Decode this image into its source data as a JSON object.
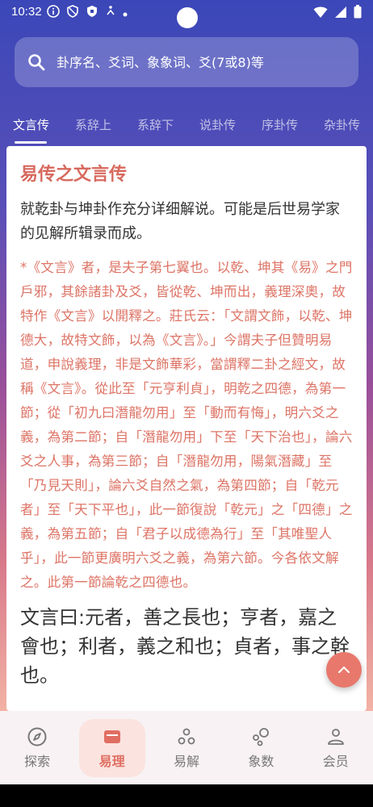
{
  "status_bar": {
    "time": "10:32"
  },
  "search": {
    "placeholder": "卦序名、爻词、象象词、爻(7或8)等"
  },
  "tabs": [
    {
      "label": "文言传"
    },
    {
      "label": "系辞上"
    },
    {
      "label": "系辞下"
    },
    {
      "label": "说卦传"
    },
    {
      "label": "序卦传"
    },
    {
      "label": "杂卦传"
    }
  ],
  "content": {
    "title": "易传之文言传",
    "subtitle": "就乾卦与坤卦作充分详细解说。可能是后世易学家的见解所辑录而成。",
    "note": "*《文言》者，是夫子第七翼也。以乾、坤其《易》之門戶邪，其餘諸卦及爻，皆從乾、坤而出，義理深奧，故特作《文言》以開釋之。莊氏云：「文謂文飾，以乾、坤德大，故特文飾，以為《文言》。」今謂夫子但贊明易道，申說義理，非是文飾華彩，當謂釋二卦之經文，故稱《文言》。從此至「元亨利貞」，明乾之四德，為第一節；從「初九曰潛龍勿用」至「動而有悔」，明六爻之義，為第二節；自「潛龍勿用」下至「天下治也」，論六爻之人事，為第三節；自「潛龍勿用，陽氣潛藏」至「乃見天則」，論六爻自然之氣，為第四節；自「乾元者」至「天下平也」，此一節復說「乾元」之「四德」之義，為第五節；自「君子以成德為行」至「其唯聖人乎」，此一節更廣明六爻之義，為第六節。今各依文解之。此第一節論乾之四德也。",
    "body": "文言曰:元者，善之長也；亨者，嘉之會也；利者，義之和也；貞者，事之幹也。"
  },
  "bottom_nav": [
    {
      "label": "探索",
      "icon": "compass-icon"
    },
    {
      "label": "易理",
      "icon": "book-icon"
    },
    {
      "label": "易解",
      "icon": "dots-icon"
    },
    {
      "label": "象数",
      "icon": "bubbles-icon"
    },
    {
      "label": "会员",
      "icon": "person-icon"
    }
  ],
  "colors": {
    "accent": "#e06e62",
    "note": "#dd7466",
    "header": "#3b47b8"
  }
}
